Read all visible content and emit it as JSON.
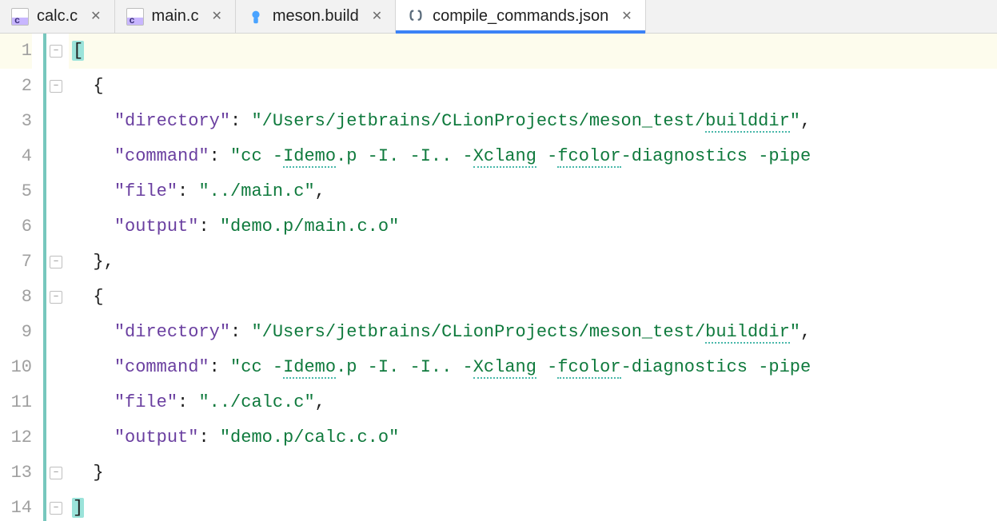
{
  "tabs": [
    {
      "label": "calc.c",
      "icon": "c",
      "active": false
    },
    {
      "label": "main.c",
      "icon": "c",
      "active": false
    },
    {
      "label": "meson.build",
      "icon": "meson",
      "active": false
    },
    {
      "label": "compile_commands.json",
      "icon": "json",
      "active": true
    }
  ],
  "line_count": 14,
  "highlighted_line": 1,
  "fold_markers": [
    {
      "line": 1,
      "kind": "open"
    },
    {
      "line": 2,
      "kind": "open"
    },
    {
      "line": 7,
      "kind": "close"
    },
    {
      "line": 8,
      "kind": "open"
    },
    {
      "line": 13,
      "kind": "close"
    },
    {
      "line": 14,
      "kind": "close"
    }
  ],
  "code_lines": [
    {
      "n": 1,
      "tokens": [
        {
          "t": "[",
          "c": "bracket0"
        }
      ]
    },
    {
      "n": 2,
      "tokens": [
        {
          "t": "  {",
          "c": "pun"
        }
      ]
    },
    {
      "n": 3,
      "tokens": [
        {
          "t": "    ",
          "c": "pun"
        },
        {
          "t": "\"directory\"",
          "c": "key"
        },
        {
          "t": ": ",
          "c": "pun"
        },
        {
          "t": "\"/Users/jetbrains/CLionProjects/meson_test/",
          "c": "str"
        },
        {
          "t": "builddir",
          "c": "str squig"
        },
        {
          "t": "\"",
          "c": "str"
        },
        {
          "t": ",",
          "c": "pun"
        }
      ]
    },
    {
      "n": 4,
      "tokens": [
        {
          "t": "    ",
          "c": "pun"
        },
        {
          "t": "\"command\"",
          "c": "key"
        },
        {
          "t": ": ",
          "c": "pun"
        },
        {
          "t": "\"cc -",
          "c": "str"
        },
        {
          "t": "Idemo",
          "c": "str squig"
        },
        {
          "t": ".p -I. -I.. -",
          "c": "str"
        },
        {
          "t": "Xclang",
          "c": "str squig"
        },
        {
          "t": " -",
          "c": "str"
        },
        {
          "t": "fcolor",
          "c": "str squig"
        },
        {
          "t": "-diagnostics -pipe",
          "c": "str"
        }
      ]
    },
    {
      "n": 5,
      "tokens": [
        {
          "t": "    ",
          "c": "pun"
        },
        {
          "t": "\"file\"",
          "c": "key"
        },
        {
          "t": ": ",
          "c": "pun"
        },
        {
          "t": "\"../main.c\"",
          "c": "str"
        },
        {
          "t": ",",
          "c": "pun"
        }
      ]
    },
    {
      "n": 6,
      "tokens": [
        {
          "t": "    ",
          "c": "pun"
        },
        {
          "t": "\"output\"",
          "c": "key"
        },
        {
          "t": ": ",
          "c": "pun"
        },
        {
          "t": "\"demo.p/main.c.o\"",
          "c": "str"
        }
      ]
    },
    {
      "n": 7,
      "tokens": [
        {
          "t": "  },",
          "c": "pun"
        }
      ]
    },
    {
      "n": 8,
      "tokens": [
        {
          "t": "  {",
          "c": "pun"
        }
      ]
    },
    {
      "n": 9,
      "tokens": [
        {
          "t": "    ",
          "c": "pun"
        },
        {
          "t": "\"directory\"",
          "c": "key"
        },
        {
          "t": ": ",
          "c": "pun"
        },
        {
          "t": "\"/Users/jetbrains/CLionProjects/meson_test/",
          "c": "str"
        },
        {
          "t": "builddir",
          "c": "str squig"
        },
        {
          "t": "\"",
          "c": "str"
        },
        {
          "t": ",",
          "c": "pun"
        }
      ]
    },
    {
      "n": 10,
      "tokens": [
        {
          "t": "    ",
          "c": "pun"
        },
        {
          "t": "\"command\"",
          "c": "key"
        },
        {
          "t": ": ",
          "c": "pun"
        },
        {
          "t": "\"cc -",
          "c": "str"
        },
        {
          "t": "Idemo",
          "c": "str squig"
        },
        {
          "t": ".p -I. -I.. -",
          "c": "str"
        },
        {
          "t": "Xclang",
          "c": "str squig"
        },
        {
          "t": " -",
          "c": "str"
        },
        {
          "t": "fcolor",
          "c": "str squig"
        },
        {
          "t": "-diagnostics -pipe",
          "c": "str"
        }
      ]
    },
    {
      "n": 11,
      "tokens": [
        {
          "t": "    ",
          "c": "pun"
        },
        {
          "t": "\"file\"",
          "c": "key"
        },
        {
          "t": ": ",
          "c": "pun"
        },
        {
          "t": "\"../calc.c\"",
          "c": "str"
        },
        {
          "t": ",",
          "c": "pun"
        }
      ]
    },
    {
      "n": 12,
      "tokens": [
        {
          "t": "    ",
          "c": "pun"
        },
        {
          "t": "\"output\"",
          "c": "key"
        },
        {
          "t": ": ",
          "c": "pun"
        },
        {
          "t": "\"demo.p/calc.c.o\"",
          "c": "str"
        }
      ]
    },
    {
      "n": 13,
      "tokens": [
        {
          "t": "  }",
          "c": "pun"
        }
      ]
    },
    {
      "n": 14,
      "tokens": [
        {
          "t": "]",
          "c": "bracket0"
        }
      ]
    }
  ]
}
